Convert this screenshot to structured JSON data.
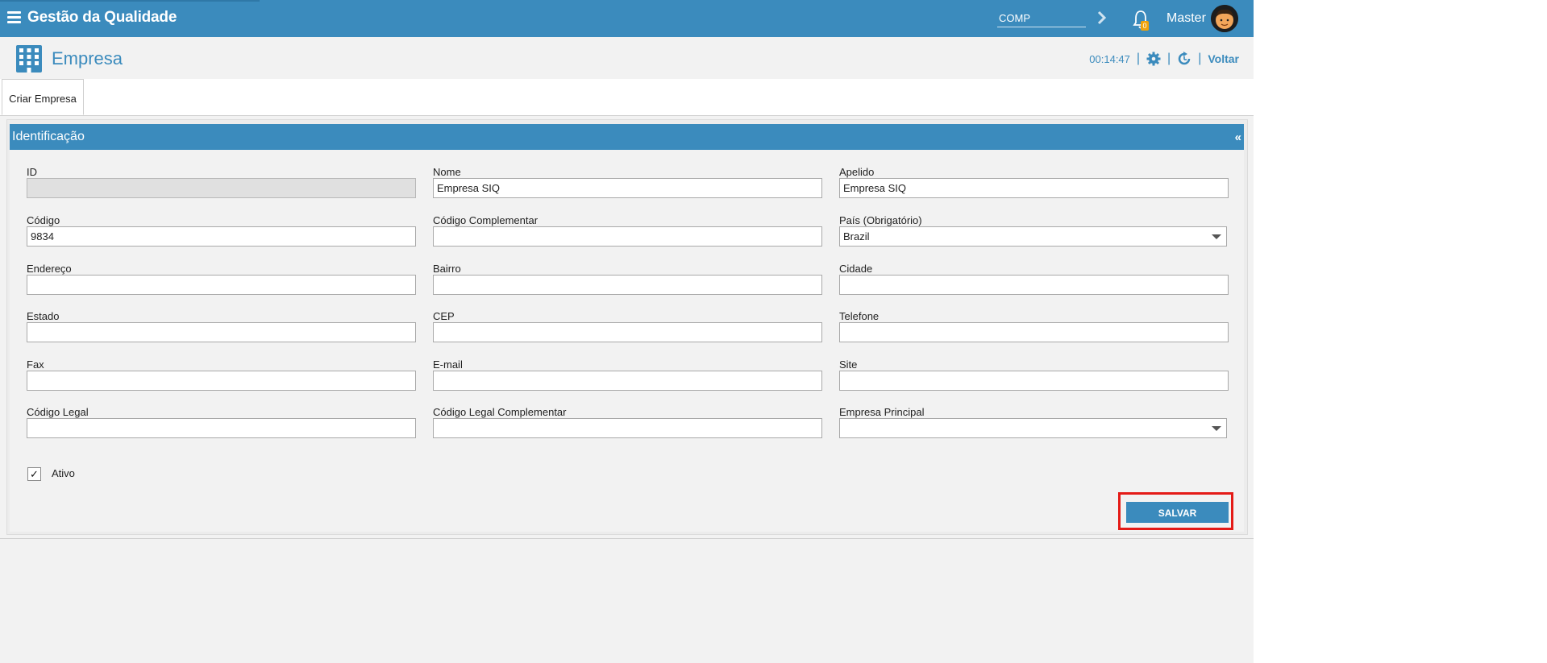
{
  "topbar": {
    "title": "Gestão da Qualidade",
    "company_value": "COMP",
    "notifications_count": "0",
    "user_name": "Master"
  },
  "page": {
    "title": "Empresa",
    "clock": "00:14:47",
    "back_label": "Voltar"
  },
  "tabs": [
    {
      "label": "Criar Empresa",
      "active": true
    }
  ],
  "section": {
    "title": "Identificação",
    "collapse_glyph": "«"
  },
  "fields": {
    "id": {
      "label": "ID",
      "value": ""
    },
    "nome": {
      "label": "Nome",
      "value": "Empresa SIQ"
    },
    "apelido": {
      "label": "Apelido",
      "value": "Empresa SIQ"
    },
    "codigo": {
      "label": "Código",
      "value": "9834"
    },
    "codigo_complementar": {
      "label": "Código Complementar",
      "value": ""
    },
    "pais": {
      "label": "País (Obrigatório)",
      "value": "Brazil"
    },
    "endereco": {
      "label": "Endereço",
      "value": ""
    },
    "bairro": {
      "label": "Bairro",
      "value": ""
    },
    "cidade": {
      "label": "Cidade",
      "value": ""
    },
    "estado": {
      "label": "Estado",
      "value": ""
    },
    "cep": {
      "label": "CEP",
      "value": ""
    },
    "telefone": {
      "label": "Telefone",
      "value": ""
    },
    "fax": {
      "label": "Fax",
      "value": ""
    },
    "email": {
      "label": "E-mail",
      "value": ""
    },
    "site": {
      "label": "Site",
      "value": ""
    },
    "codigo_legal": {
      "label": "Código Legal",
      "value": ""
    },
    "codigo_legal_complementar": {
      "label": "Código Legal Complementar",
      "value": ""
    },
    "empresa_principal": {
      "label": "Empresa Principal",
      "value": ""
    }
  },
  "ativo": {
    "label": "Ativo",
    "checked": true,
    "check_glyph": "✓"
  },
  "actions": {
    "save_label": "SALVAR"
  },
  "colors": {
    "primary": "#3b8bbd",
    "highlight": "#e41b17",
    "badge": "#f0a30a"
  }
}
